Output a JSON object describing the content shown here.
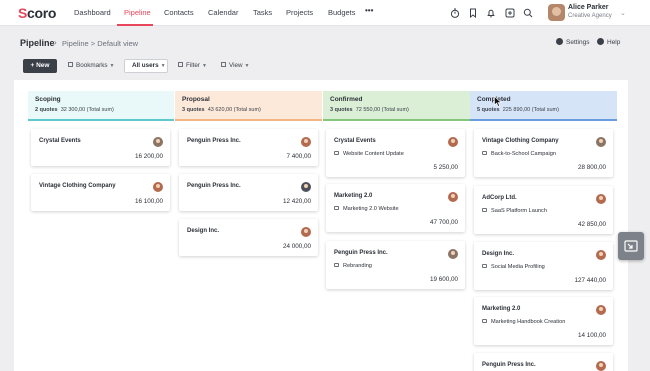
{
  "app": {
    "logo_text": "coro",
    "logo_letter": "S"
  },
  "nav": {
    "items": [
      "Dashboard",
      "Pipeline",
      "Contacts",
      "Calendar",
      "Tasks",
      "Projects",
      "Budgets"
    ],
    "more": "•••",
    "active": "Pipeline"
  },
  "top_icons": [
    "stopwatch-icon",
    "bookmark-icon",
    "bell-icon",
    "plus-square-icon",
    "search-icon"
  ],
  "user": {
    "name": "Alice Parker",
    "company": "Creative Agency"
  },
  "breadcrumb": {
    "title": "Pipeline",
    "separator": "›",
    "rest": "Pipeline > Default view"
  },
  "header_actions": {
    "settings": "Settings",
    "help": "Help"
  },
  "toolbar": {
    "new_label": "+ New",
    "bookmarks": "Bookmarks",
    "all_users": "All users",
    "filter": "Filter",
    "view": "View"
  },
  "columns": [
    {
      "title": "Scoping",
      "count": "2 quotes",
      "sum": "32 300,00 (Total sum)",
      "bg": "#e9f8f9",
      "bar": "#5ec8cf"
    },
    {
      "title": "Proposal",
      "count": "3 quotes",
      "sum": "43 620,00 (Total sum)",
      "bg": "#fde9d9",
      "bar": "#f3b582"
    },
    {
      "title": "Confirmed",
      "count": "3 quotes",
      "sum": "72 550,00 (Total sum)",
      "bg": "#dbefd7",
      "bar": "#84c77b"
    },
    {
      "title": "Completed",
      "count": "5 quotes",
      "sum": "225 890,00 (Total sum)",
      "bg": "#d6e4f8",
      "bar": "#6b9be0"
    }
  ],
  "cards": {
    "scoping": [
      {
        "title": "Crystal Events",
        "amount": "16 200,00"
      },
      {
        "title": "Vintage Clothing Company",
        "amount": "16 100,00"
      }
    ],
    "proposal": [
      {
        "title": "Penguin Press Inc.",
        "amount": "7 400,00"
      },
      {
        "title": "Penguin Press Inc.",
        "amount": "12 420,00"
      },
      {
        "title": "Design Inc.",
        "amount": "24 000,00"
      }
    ],
    "confirmed": [
      {
        "title": "Crystal Events",
        "sub": "Website Content Update",
        "amount": "5 250,00"
      },
      {
        "title": "Marketing 2.0",
        "sub": "Marketing 2.0 Website",
        "amount": "47 700,00"
      },
      {
        "title": "Penguin Press Inc.",
        "sub": "Rebranding",
        "amount": "19 600,00"
      }
    ],
    "completed": [
      {
        "title": "Vintage Clothing Company",
        "sub": "Back-to-School Campaign",
        "amount": "28 800,00"
      },
      {
        "title": "AdCorp Ltd.",
        "sub": "SaaS Platform Launch",
        "amount": "42 850,00"
      },
      {
        "title": "Design Inc.",
        "sub": "Social Media Profiling",
        "amount": "127 440,00"
      },
      {
        "title": "Marketing 2.0",
        "sub": "Marketing Handbook Creation",
        "amount": "14 100,00"
      },
      {
        "title": "Penguin Press Inc."
      }
    ]
  },
  "colors": {
    "accent": "#e8465b",
    "new_button": "#3b4048"
  }
}
